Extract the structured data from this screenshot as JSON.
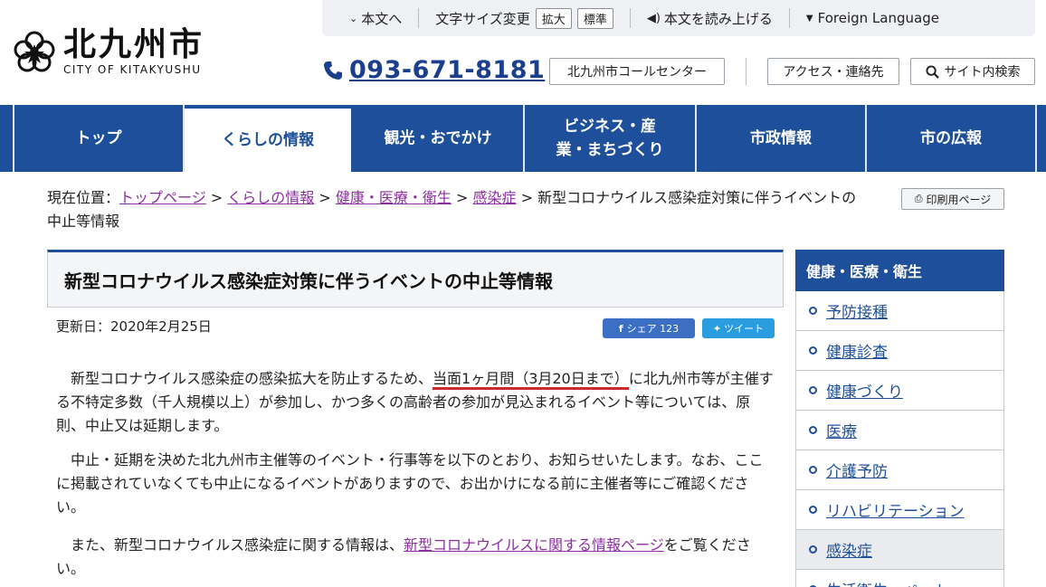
{
  "header": {
    "logo_jp": "北九州市",
    "logo_en": "CITY OF KITAKYUSHU",
    "util": {
      "skip_to_content": "本文へ",
      "font_size_label": "文字サイズ変更",
      "font_large": "拡大",
      "font_standard": "標準",
      "read_aloud": "本文を読み上げる",
      "foreign_language": "Foreign Language"
    },
    "phone": "093-671-8181",
    "call_center": "北九州市コールセンター",
    "access": "アクセス・連絡先",
    "site_search": "サイト内検索"
  },
  "nav": {
    "items": [
      {
        "label": "トップ"
      },
      {
        "label": "くらしの情報"
      },
      {
        "label": "観光・おでかけ"
      },
      {
        "label": "ビジネス・産業・まちづくり"
      },
      {
        "label": "市政情報"
      },
      {
        "label": "市の広報"
      }
    ],
    "active_index": 1
  },
  "breadcrumb": {
    "prefix": "現在位置：",
    "links": [
      "トップページ",
      "くらしの情報",
      "健康・医療・衛生",
      "感染症"
    ],
    "separator": ">",
    "current": "新型コロナウイルス感染症対策に伴うイベントの中止等情報"
  },
  "print_page": "印刷用ページ",
  "main": {
    "title": "新型コロナウイルス感染症対策に伴うイベントの中止等情報",
    "updated": "更新日：2020年2月25日",
    "share": "シェア 123",
    "tweet": "ツイート",
    "p1_a": "　新型コロナウイルス感染症の感染拡大を防止するため、",
    "p1_highlight": "当面1ヶ月間（3月20日まで）",
    "p1_b": "に北九州市等が主催する不特定多数（千人規模以上）が参加し、かつ多くの高齢者の参加が見込まれるイベント等については、原則、中止又は延期します。",
    "p2": "　中止・延期を決めた北九州市主催等のイベント・行事等を以下のとおり、お知らせいたします。なお、ここに掲載されていなくても中止になるイベントがありますので、お出かけになる前に主催者等にご確認ください。",
    "p3_a": "　また、新型コロナウイルス感染症に関する情報は、",
    "p3_link": "新型コロナウイルスに関する情報ページ",
    "p3_b": "をご覧ください。"
  },
  "sidebar": {
    "heading": "健康・医療・衛生",
    "items": [
      {
        "label": "予防接種"
      },
      {
        "label": "健康診査"
      },
      {
        "label": "健康づくり"
      },
      {
        "label": "医療"
      },
      {
        "label": "介護予防"
      },
      {
        "label": "リハビリテーション"
      },
      {
        "label": "感染症"
      },
      {
        "label": "生活衛生・ペット"
      }
    ],
    "current_index": 6
  },
  "colors": {
    "brand_blue": "#1e4f9a",
    "visited_link": "#8c2fa0",
    "highlight_underline": "#cc2b2b"
  }
}
